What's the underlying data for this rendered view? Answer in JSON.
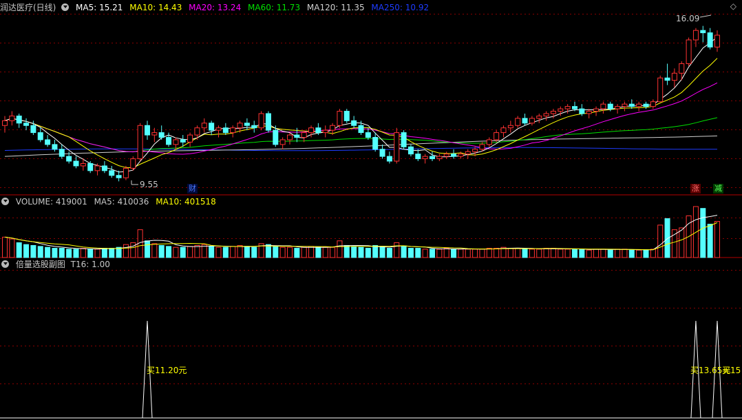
{
  "price_panel": {
    "title": "润达医疗(日线)",
    "ma": [
      {
        "label": "MA5: 15.21",
        "color": "#ffffff"
      },
      {
        "label": "MA10: 14.43",
        "color": "#ffff00"
      },
      {
        "label": "MA20: 13.24",
        "color": "#ff00ff"
      },
      {
        "label": "MA60: 11.73",
        "color": "#00e000"
      },
      {
        "label": "MA120: 11.35",
        "color": "#d0d0d0"
      },
      {
        "label": "MA250: 10.92",
        "color": "#0000ff"
      }
    ],
    "high_label": "16.09",
    "low_label": "9.55",
    "marker_cai": "财",
    "marker_zhang": "涨",
    "marker_jian": "减",
    "diamond_icon": "diamond-icon"
  },
  "volume_panel": {
    "title": "VOLUME: 419001",
    "ma5": "MA5: 410036",
    "ma10": "MA10: 401518"
  },
  "indicator_panel": {
    "title": "倍量选股副图",
    "t16": "T16: 1.00",
    "signals": [
      "买11.20元",
      "买13.65元",
      "买15"
    ]
  },
  "colors": {
    "up": "#ff3232",
    "down": "#54ffff",
    "grid": "#8b0000",
    "text": "#c8c8c8"
  },
  "chart_data": {
    "type": "candlestick",
    "ohlc": [
      [
        11.9,
        12.3,
        11.6,
        12.1
      ],
      [
        12.1,
        12.5,
        11.9,
        12.3
      ],
      [
        12.3,
        12.4,
        11.8,
        12.0
      ],
      [
        12.0,
        12.2,
        11.7,
        11.9
      ],
      [
        11.9,
        12.1,
        11.5,
        11.6
      ],
      [
        11.6,
        11.8,
        11.2,
        11.3
      ],
      [
        11.3,
        11.5,
        11.0,
        11.1
      ],
      [
        11.1,
        11.3,
        10.8,
        10.9
      ],
      [
        10.9,
        11.1,
        10.5,
        10.6
      ],
      [
        10.6,
        10.8,
        10.3,
        10.4
      ],
      [
        10.4,
        10.6,
        10.1,
        10.2
      ],
      [
        10.2,
        10.5,
        10.0,
        10.3
      ],
      [
        10.3,
        10.4,
        9.9,
        10.0
      ],
      [
        10.0,
        10.3,
        9.8,
        10.2
      ],
      [
        10.2,
        10.4,
        9.9,
        10.0
      ],
      [
        10.0,
        10.2,
        9.7,
        9.8
      ],
      [
        9.8,
        10.0,
        9.55,
        9.7
      ],
      [
        9.7,
        10.2,
        9.6,
        10.1
      ],
      [
        10.1,
        10.6,
        10.0,
        10.5
      ],
      [
        10.5,
        12.0,
        10.4,
        11.9
      ],
      [
        11.9,
        12.1,
        11.3,
        11.5
      ],
      [
        11.5,
        11.8,
        11.2,
        11.6
      ],
      [
        11.6,
        11.9,
        11.3,
        11.4
      ],
      [
        11.4,
        11.6,
        11.0,
        11.1
      ],
      [
        11.1,
        11.4,
        10.9,
        11.3
      ],
      [
        11.3,
        11.5,
        11.0,
        11.2
      ],
      [
        11.2,
        11.6,
        11.0,
        11.5
      ],
      [
        11.5,
        11.9,
        11.3,
        11.8
      ],
      [
        11.8,
        12.2,
        11.6,
        12.0
      ],
      [
        12.0,
        12.1,
        11.5,
        11.7
      ],
      [
        11.7,
        11.9,
        11.4,
        11.8
      ],
      [
        11.8,
        12.0,
        11.5,
        11.6
      ],
      [
        11.6,
        11.9,
        11.4,
        11.8
      ],
      [
        11.8,
        12.1,
        11.6,
        12.0
      ],
      [
        12.0,
        12.2,
        11.7,
        11.9
      ],
      [
        11.9,
        12.1,
        11.6,
        11.8
      ],
      [
        11.8,
        12.5,
        11.7,
        12.4
      ],
      [
        12.4,
        12.5,
        11.6,
        11.7
      ],
      [
        11.7,
        11.9,
        11.0,
        11.1
      ],
      [
        11.1,
        11.4,
        10.9,
        11.3
      ],
      [
        11.3,
        11.6,
        11.1,
        11.5
      ],
      [
        11.5,
        11.8,
        11.2,
        11.4
      ],
      [
        11.4,
        11.7,
        11.2,
        11.6
      ],
      [
        11.6,
        11.9,
        11.4,
        11.8
      ],
      [
        11.8,
        12.0,
        11.5,
        11.6
      ],
      [
        11.6,
        11.9,
        11.4,
        11.7
      ],
      [
        11.7,
        12.0,
        11.5,
        11.9
      ],
      [
        11.9,
        12.6,
        11.8,
        12.5
      ],
      [
        12.5,
        12.6,
        12.0,
        12.1
      ],
      [
        12.1,
        12.3,
        11.8,
        11.9
      ],
      [
        11.9,
        12.1,
        11.5,
        11.6
      ],
      [
        11.6,
        11.8,
        11.3,
        11.4
      ],
      [
        11.4,
        11.6,
        10.8,
        10.9
      ],
      [
        10.9,
        11.1,
        10.5,
        10.6
      ],
      [
        10.6,
        10.8,
        10.3,
        10.4
      ],
      [
        10.4,
        11.8,
        10.3,
        11.6
      ],
      [
        11.6,
        11.7,
        10.9,
        11.0
      ],
      [
        11.0,
        11.1,
        10.6,
        10.7
      ],
      [
        10.7,
        10.9,
        10.4,
        10.5
      ],
      [
        10.5,
        10.7,
        10.3,
        10.6
      ],
      [
        10.6,
        10.8,
        10.4,
        10.5
      ],
      [
        10.5,
        10.7,
        10.4,
        10.6
      ],
      [
        10.6,
        10.8,
        10.5,
        10.7
      ],
      [
        10.7,
        10.9,
        10.5,
        10.6
      ],
      [
        10.6,
        10.8,
        10.5,
        10.7
      ],
      [
        10.7,
        10.9,
        10.5,
        10.8
      ],
      [
        10.8,
        11.0,
        10.6,
        10.9
      ],
      [
        10.9,
        11.2,
        10.8,
        11.1
      ],
      [
        11.1,
        11.4,
        11.0,
        11.3
      ],
      [
        11.3,
        11.7,
        11.2,
        11.6
      ],
      [
        11.6,
        11.9,
        11.4,
        11.8
      ],
      [
        11.8,
        12.1,
        11.6,
        11.9
      ],
      [
        11.9,
        12.3,
        11.8,
        12.2
      ],
      [
        12.2,
        12.4,
        11.9,
        12.0
      ],
      [
        12.0,
        12.3,
        11.9,
        12.2
      ],
      [
        12.2,
        12.4,
        12.0,
        12.3
      ],
      [
        12.3,
        12.5,
        12.1,
        12.4
      ],
      [
        12.4,
        12.6,
        12.2,
        12.5
      ],
      [
        12.5,
        12.7,
        12.3,
        12.6
      ],
      [
        12.6,
        12.8,
        12.4,
        12.7
      ],
      [
        12.7,
        12.9,
        12.5,
        12.6
      ],
      [
        12.6,
        12.8,
        12.3,
        12.4
      ],
      [
        12.4,
        12.6,
        12.2,
        12.5
      ],
      [
        12.5,
        12.7,
        12.3,
        12.6
      ],
      [
        12.6,
        12.9,
        12.4,
        12.8
      ],
      [
        12.8,
        12.9,
        12.5,
        12.6
      ],
      [
        12.6,
        12.8,
        12.4,
        12.7
      ],
      [
        12.7,
        12.9,
        12.5,
        12.8
      ],
      [
        12.8,
        13.0,
        12.6,
        12.7
      ],
      [
        12.7,
        12.9,
        12.5,
        12.8
      ],
      [
        12.8,
        12.9,
        12.6,
        12.7
      ],
      [
        12.7,
        13.0,
        12.6,
        12.9
      ],
      [
        12.9,
        14.0,
        12.9,
        13.9
      ],
      [
        13.9,
        14.5,
        13.6,
        13.8
      ],
      [
        13.8,
        14.3,
        13.5,
        14.1
      ],
      [
        14.1,
        14.6,
        13.8,
        14.5
      ],
      [
        14.5,
        15.6,
        14.4,
        15.5
      ],
      [
        15.5,
        16.0,
        15.2,
        15.9
      ],
      [
        15.9,
        16.09,
        15.4,
        15.8
      ],
      [
        15.8,
        16.0,
        15.1,
        15.2
      ],
      [
        15.2,
        15.9,
        15.0,
        15.7
      ]
    ],
    "volume": [
      2.2,
      2.0,
      1.6,
      1.4,
      1.3,
      1.2,
      1.1,
      1.0,
      1.0,
      0.9,
      0.9,
      1.0,
      0.9,
      0.9,
      1.0,
      1.0,
      1.1,
      1.4,
      1.6,
      3.0,
      1.8,
      1.5,
      1.3,
      1.2,
      1.1,
      1.1,
      1.2,
      1.3,
      1.4,
      1.2,
      1.1,
      1.1,
      1.2,
      1.3,
      1.2,
      1.1,
      1.5,
      1.4,
      1.2,
      1.1,
      1.1,
      1.0,
      1.1,
      1.2,
      1.1,
      1.1,
      1.1,
      1.8,
      1.3,
      1.2,
      1.1,
      1.0,
      1.3,
      1.2,
      1.0,
      1.6,
      1.2,
      1.0,
      1.0,
      0.9,
      0.9,
      0.9,
      1.0,
      0.9,
      0.9,
      0.9,
      0.9,
      0.9,
      1.0,
      1.0,
      1.1,
      1.0,
      1.0,
      0.9,
      0.9,
      0.9,
      1.0,
      1.0,
      0.9,
      0.9,
      0.9,
      0.9,
      0.8,
      0.9,
      0.9,
      0.8,
      0.9,
      0.9,
      0.8,
      0.8,
      0.8,
      0.9,
      3.5,
      4.2,
      3.0,
      3.2,
      4.5,
      5.5,
      5.3,
      3.6,
      3.9
    ],
    "signals": [
      {
        "index": 20,
        "label": "买11.20元"
      },
      {
        "index": 97,
        "label": "买13.65元"
      },
      {
        "index": 100,
        "label": "买15"
      }
    ],
    "price_range": [
      9.3,
      16.6
    ],
    "legend": "top-left",
    "grid": true
  }
}
